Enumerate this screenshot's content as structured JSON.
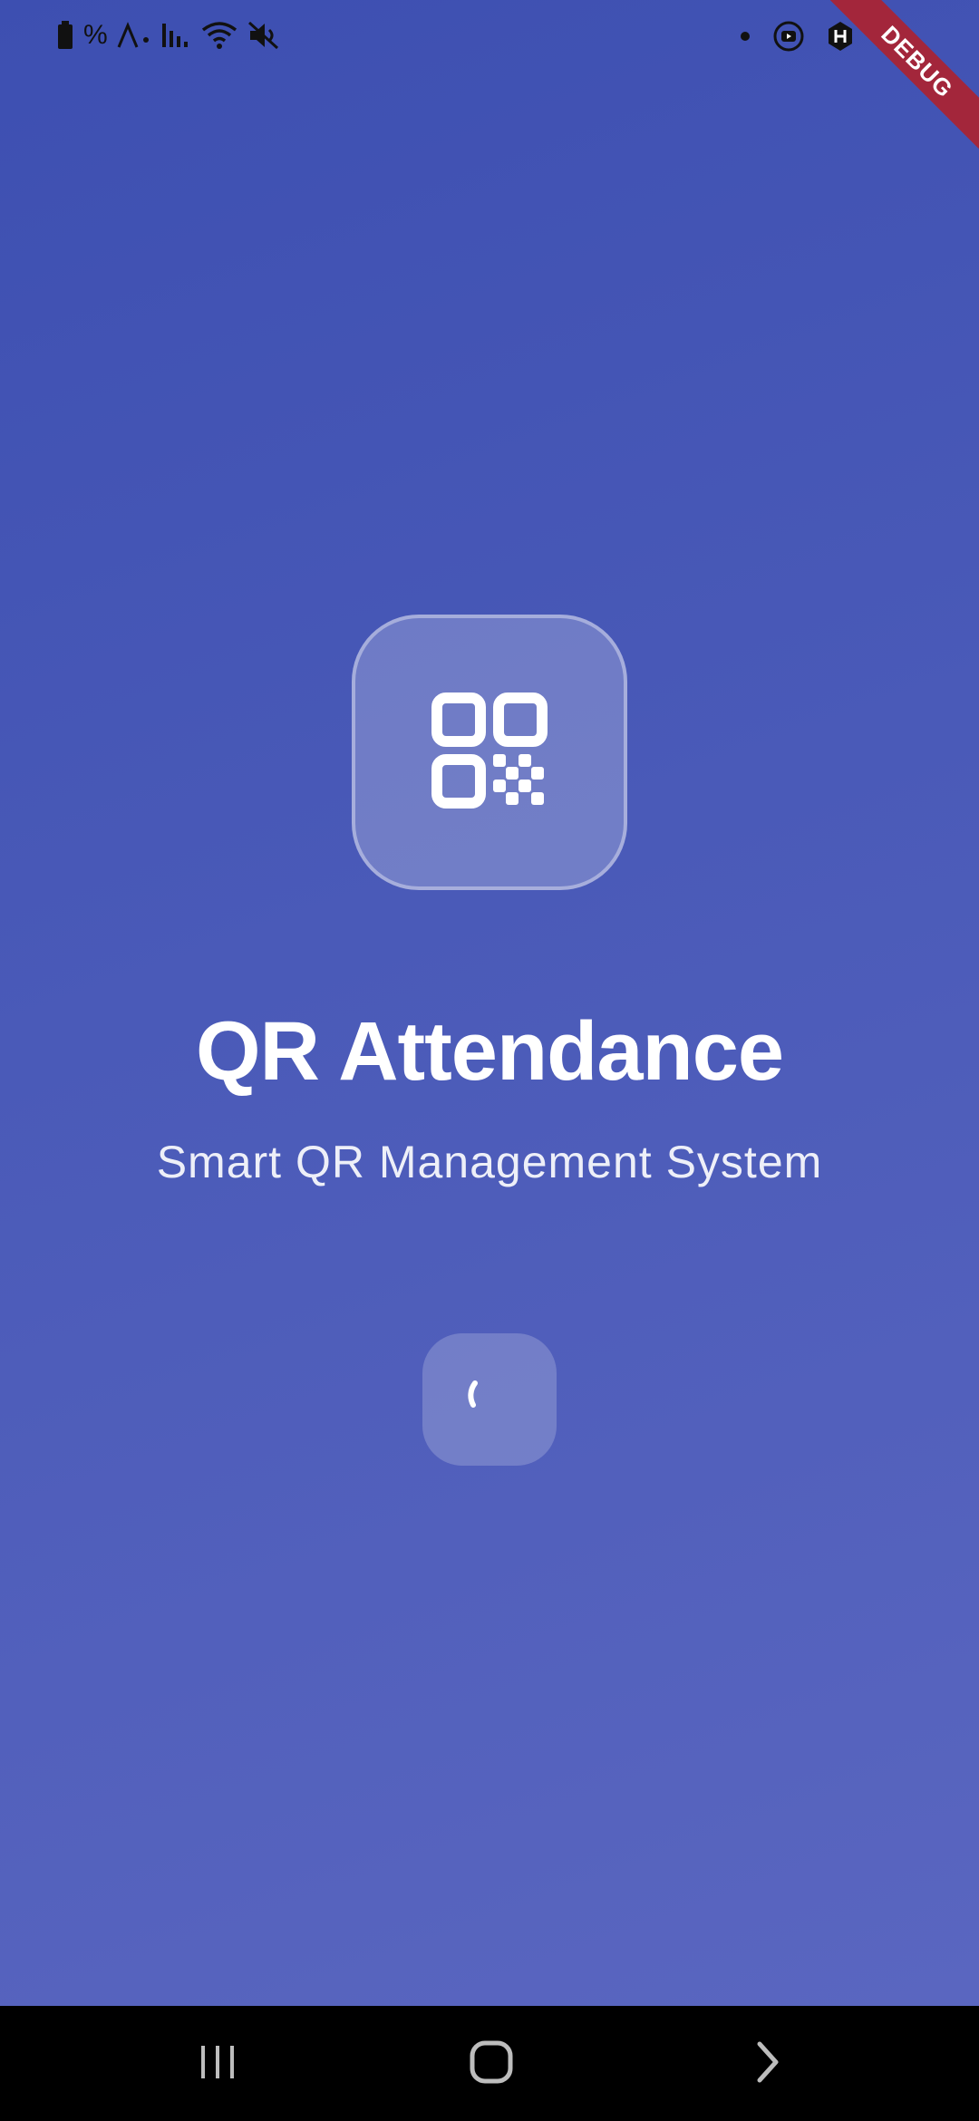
{
  "status_bar": {
    "left_icons": [
      "battery-icon",
      "percent-icon",
      "signal-activity-icon",
      "cell-signal-icon",
      "wifi-icon",
      "mute-icon"
    ],
    "percent_glyph": "%",
    "right_icons": [
      "dot-icon",
      "youtube-icon",
      "app-icon",
      "gallery-icon"
    ]
  },
  "debug_banner": "DEBUG",
  "splash": {
    "logo_icon": "qr-code-icon",
    "title": "QR Attendance",
    "subtitle": "Smart QR Management System",
    "loader_icon": "progress-spinner-icon"
  },
  "nav_bar": {
    "recents_icon": "recents-icon",
    "home_icon": "home-icon",
    "back_icon": "back-icon"
  },
  "colors": {
    "gradient_top": "#3d4fb1",
    "gradient_bottom": "#5a66c0",
    "debug_banner": "#a3263b"
  }
}
